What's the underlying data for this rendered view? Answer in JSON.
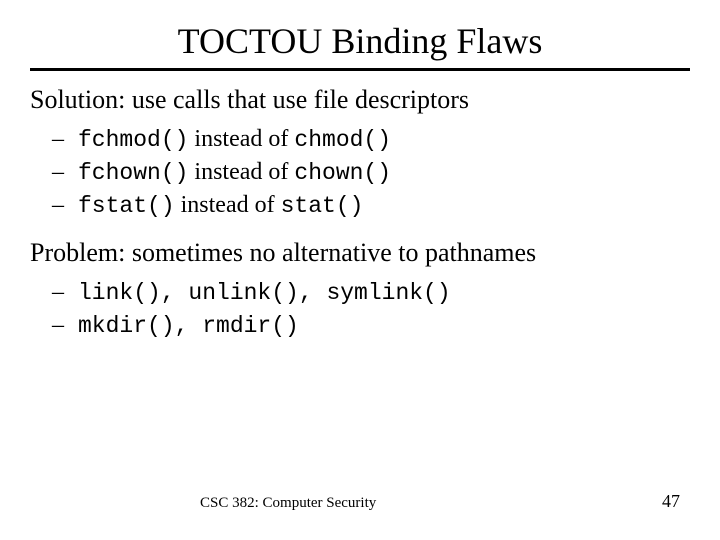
{
  "title": "TOCTOU Binding Flaws",
  "solution": {
    "heading": "Solution: use calls that use file descriptors",
    "items": [
      {
        "func_a": "fchmod()",
        "mid": " instead of ",
        "func_b": "chmod()"
      },
      {
        "func_a": "fchown()",
        "mid": " instead of ",
        "func_b": "chown()"
      },
      {
        "func_a": "fstat()",
        "mid": " instead of ",
        "func_b": "stat()"
      }
    ]
  },
  "problem": {
    "heading": "Problem: sometimes no alternative to pathnames",
    "items": [
      {
        "text": "link(), unlink(), symlink()"
      },
      {
        "text": "mkdir(), rmdir()"
      }
    ]
  },
  "footer": {
    "course": "CSC 382: Computer Security",
    "page": "47"
  }
}
